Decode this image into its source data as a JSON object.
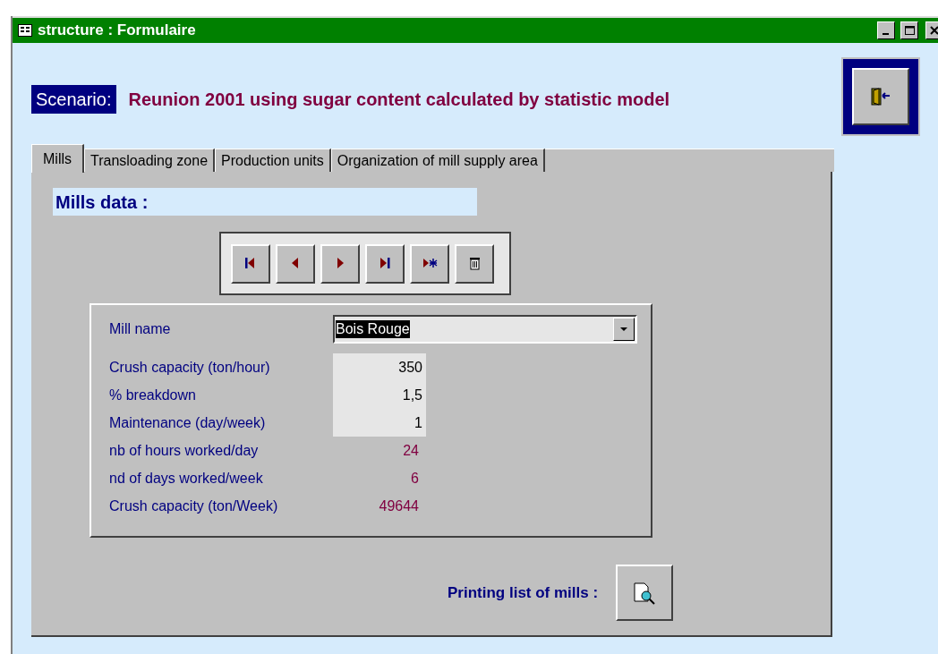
{
  "window": {
    "title": "structure : Formulaire"
  },
  "scenario": {
    "label": "Scenario:",
    "value": "Reunion 2001 using sugar content calculated by statistic model"
  },
  "tabs": [
    {
      "label": "Mills",
      "selected": true
    },
    {
      "label": "Transloading zone",
      "selected": false
    },
    {
      "label": "Production units",
      "selected": false
    },
    {
      "label": "Organization of mill supply area",
      "selected": false
    }
  ],
  "section_title": "Mills data :",
  "navigation": [
    {
      "kind": "first"
    },
    {
      "kind": "previous"
    },
    {
      "kind": "next"
    },
    {
      "kind": "last"
    },
    {
      "kind": "new"
    },
    {
      "kind": "delete"
    }
  ],
  "mill_name": {
    "label": "Mill name",
    "value": "Bois Rouge"
  },
  "fields": [
    {
      "label": "Crush capacity (ton/hour)",
      "value": "350",
      "kind": "input"
    },
    {
      "label": "% breakdown",
      "value": "1,5",
      "kind": "input"
    },
    {
      "label": "Maintenance (day/week)",
      "value": "1",
      "kind": "input"
    },
    {
      "label": "nb of hours worked/day",
      "value": "24",
      "kind": "computed"
    },
    {
      "label": "nd of days worked/week",
      "value": "6",
      "kind": "computed"
    },
    {
      "label": "Crush capacity (ton/Week)",
      "value": "49644",
      "kind": "computed"
    }
  ],
  "print": {
    "label": "Printing list of mills :"
  }
}
